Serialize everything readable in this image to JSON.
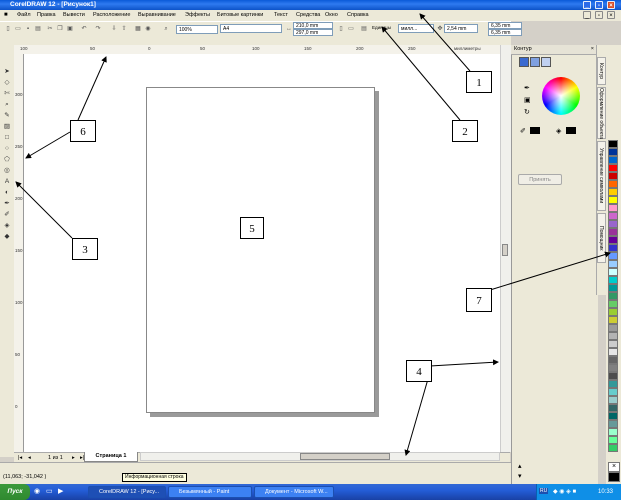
{
  "window": {
    "title": "CorelDRAW 12 - [Рисунок1]"
  },
  "menu": [
    "Файл",
    "Правка",
    "Вывести",
    "Расположение",
    "Выравнивание",
    "Эффекты",
    "Битовые картинки",
    "Текст",
    "Средства",
    "Окно",
    "Справка"
  ],
  "toolbar": {
    "zoom": "100%",
    "paper_size": "A4",
    "width": "210,0 mm",
    "height": "297,0 mm",
    "units_label": "Единицы",
    "units": "милл...",
    "nudge": "2,54 mm",
    "dup_x": "6,35 mm",
    "dup_y": "6,35 mm"
  },
  "ruler": {
    "unit": "миллиметры",
    "h_ticks": [
      "100",
      "50",
      "0",
      "50",
      "100",
      "150",
      "200",
      "250",
      "300"
    ],
    "v_ticks": [
      "300",
      "250",
      "200",
      "150",
      "100",
      "50",
      "0"
    ]
  },
  "pager": {
    "count": "1 из 1",
    "tab": "Страница 1"
  },
  "status": {
    "coords": "(11,063; -31,042 )",
    "hint": "Информационная строка"
  },
  "docker": {
    "title": "Контур",
    "apply_button": "Принять",
    "tabs": [
      "Контур",
      "Оформление объекта",
      "Управление символами",
      "Помощник"
    ]
  },
  "palette_colors": [
    "#000000",
    "#003399",
    "#0066cc",
    "#ff0000",
    "#cc0000",
    "#ff6600",
    "#ffcc00",
    "#ffff00",
    "#ff99cc",
    "#cc66cc",
    "#9966cc",
    "#993399",
    "#660099",
    "#3333cc",
    "#6699ff",
    "#99ccff",
    "#ccffff",
    "#00cccc",
    "#009999",
    "#339966",
    "#66cc66",
    "#99cc33",
    "#cccc33",
    "#999999",
    "#b3b3b3",
    "#cccccc",
    "#e6e6e6",
    "#666666",
    "#808080",
    "#4d4d4d",
    "#339999",
    "#66cccc",
    "#99cccc",
    "#336666",
    "#006666",
    "#669999",
    "#99ffcc",
    "#66ff99",
    "#33cc66"
  ],
  "taskbar": {
    "start": "Пуск",
    "tasks": [
      "CorelDRAW 12 - [Рису...",
      "Безымянный - Paint",
      "Документ - Microsoft W..."
    ],
    "lang": "RU",
    "clock": "10:33"
  },
  "callouts": [
    "1",
    "2",
    "3",
    "4",
    "5",
    "6",
    "7"
  ]
}
